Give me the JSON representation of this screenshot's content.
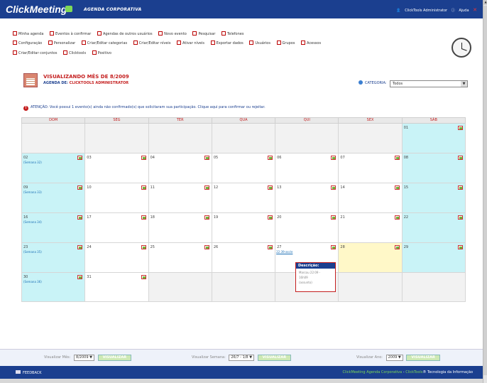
{
  "header": {
    "logo": "ClickMeeting",
    "app_title": "AGENDA CORPORATIVA",
    "user": "ClickTools Administrator",
    "help": "Ajuda"
  },
  "toolbar": {
    "row1": [
      "Minha agenda",
      "Eventos à confirmar",
      "Agendas de outros usuários",
      "Novo evento",
      "Pesquisar",
      "Telefones"
    ],
    "row2": [
      "Configuração",
      "Personalizar",
      "Criar/Editar categorias",
      "Criar/Editar níveis",
      "Ativar níveis",
      "Exportar dados",
      "Usuários",
      "Grupos",
      "Acessos"
    ],
    "row3": [
      "Criar/Editar conjuntos",
      "Clicktools",
      "Positivo"
    ]
  },
  "page": {
    "month_title": "VISUALIZANDO MÊS DE 8/2009",
    "agenda_of_label": "AGENDA DE:",
    "agenda_of_name": "CLICKTOOLS ADMINISTRATOR",
    "category_label": "CATEGORIA:",
    "category_value": "Todos",
    "warning": "ATENÇÃO: Você possui 1 evento(s) ainda não confirmado(s) que solicitaram sua participação. Clique aqui para confirmar ou rejeitar."
  },
  "calendar": {
    "days": [
      "DOM",
      "SEG",
      "TER",
      "QUA",
      "QUI",
      "SEX",
      "SÁB"
    ],
    "weeks": [
      [
        "",
        "",
        "",
        "",
        "",
        "",
        "01"
      ],
      [
        "02",
        "03",
        "04",
        "05",
        "06",
        "07",
        "08"
      ],
      [
        "09",
        "10",
        "11",
        "12",
        "13",
        "14",
        "15"
      ],
      [
        "16",
        "17",
        "18",
        "19",
        "20",
        "21",
        "22"
      ],
      [
        "23",
        "24",
        "25",
        "26",
        "27",
        "28",
        "29"
      ],
      [
        "30",
        "31",
        "",
        "",
        "",
        "",
        ""
      ]
    ],
    "week_labels": [
      "",
      "(Semana 32)",
      "(Semana 33)",
      "(Semana 34)",
      "(Semana 35)",
      "(Semana 36)"
    ],
    "event_label": "22:39-ascle"
  },
  "tooltip": {
    "title": "Descrição:",
    "lines": [
      "Marcou 22:09 -",
      "16h09",
      "(assunto)"
    ]
  },
  "bottom": {
    "month_label": "Visualizar Mês:",
    "month_value": "8/2009",
    "week_label": "Visualizar Semana:",
    "week_value": "26/7 - 1/8",
    "year_label": "Visualizar Ano:",
    "year_value": "2009",
    "view_button": "VISUALIZAR"
  },
  "footer": {
    "feedback": "FEEDBACK",
    "copyright_prefix": "ClickMeeting Agenda Corporativa",
    "copyright_mid": "ClickTools",
    "copyright_suffix": "® Tecnologia da Informação"
  }
}
